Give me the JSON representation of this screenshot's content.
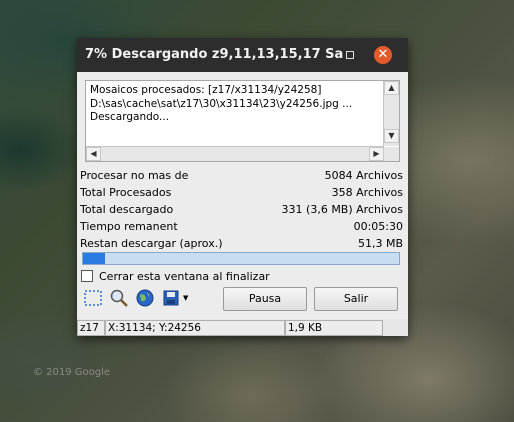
{
  "window": {
    "title": "7% Descargando z9,11,13,15,17 Sa..."
  },
  "log": {
    "lines": [
      "Mosaicos procesados: [z17/x31134/y24258]",
      "D:\\sas\\cache\\sat\\z17\\30\\x31134\\23\\y24256.jpg ...",
      "Descargando..."
    ]
  },
  "stats": [
    {
      "label": "Procesar no mas de",
      "value": "5084 Archivos"
    },
    {
      "label": "Total Procesados",
      "value": "358 Archivos"
    },
    {
      "label": "Total descargado",
      "value": "331 (3,6 MB) Archivos"
    },
    {
      "label": "Tiempo remanent",
      "value": "00:05:30"
    },
    {
      "label": "Restan descargar (aprox.)",
      "value": "51,3 MB"
    }
  ],
  "progress": {
    "percent": 7,
    "color": "#2b7ae0"
  },
  "checkbox": {
    "label": "Cerrar esta ventana al finalizar",
    "checked": false
  },
  "toolbar": {
    "icons": [
      "selection-icon",
      "zoom-icon",
      "globe-icon",
      "save-icon"
    ],
    "pause_label": "Pausa",
    "exit_label": "Salir"
  },
  "status": {
    "zoom": "z17",
    "coords": "X:31134; Y:24256",
    "size": "1,9 KB"
  },
  "map": {
    "credit": "© 2019 Google"
  },
  "colors": {
    "accent": "#e35b2a",
    "titlebar": "#2d2d2d"
  }
}
